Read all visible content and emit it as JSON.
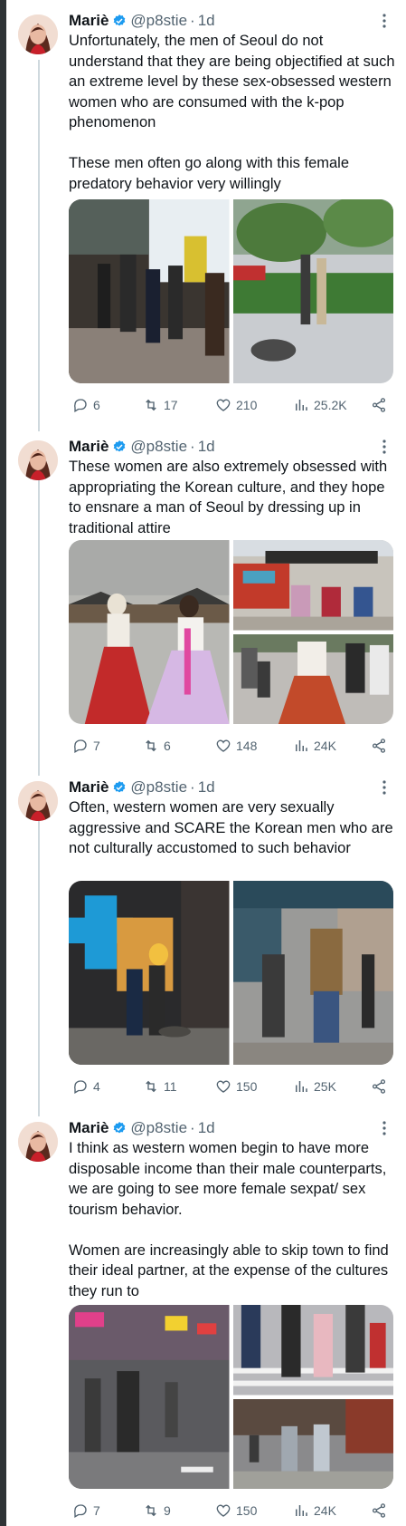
{
  "author": {
    "display_name": "Mariè",
    "handle": "@p8stie",
    "time": "1d",
    "verified_color": "#1d9bf0"
  },
  "tweets": [
    {
      "text": "Unfortunately, the men of Seoul do not understand that they are being objectified at such an extreme level by these sex-obsessed western women who are consumed with the k-pop phenomenon\n\nThese men often go along with this female predatory behavior very willingly",
      "photos": [
        "street-crowd-night",
        "sidewalk-walkers"
      ],
      "stats": {
        "replies": "6",
        "retweets": "17",
        "likes": "210",
        "views": "25.2K"
      }
    },
    {
      "text": "These women are also extremely obsessed with appropriating the Korean culture, and they hope to ensnare a man of Seoul by dressing up in traditional attire",
      "photos": [
        "hanbok-palace",
        "hanbok-gate",
        "hanbok-street"
      ],
      "stats": {
        "replies": "7",
        "retweets": "6",
        "likes": "148",
        "views": "24K"
      }
    },
    {
      "text": "Often, western women are very sexually aggressive and SCARE the Korean men who are not culturally accustomed to such behavior",
      "photos": [
        "pharmacy-sign-night",
        "shopping-street-men"
      ],
      "stats": {
        "replies": "4",
        "retweets": "11",
        "likes": "150",
        "views": "25K"
      }
    },
    {
      "text": "I think as western women begin to have more disposable income than their male counterparts, we are going to see more female sexpat/ sex tourism behavior.\n\nWomen are increasingly able to skip town to find their ideal partner, at the expense of the cultures they run to",
      "photos": [
        "night-street-crowd",
        "crosswalk-crowd",
        "alley-walkers"
      ],
      "stats": {
        "replies": "7",
        "retweets": "9",
        "likes": "150",
        "views": "24K"
      }
    }
  ],
  "colors": {
    "text": "#0f1419",
    "secondary": "#536471",
    "thread_line": "#cfd9de"
  }
}
